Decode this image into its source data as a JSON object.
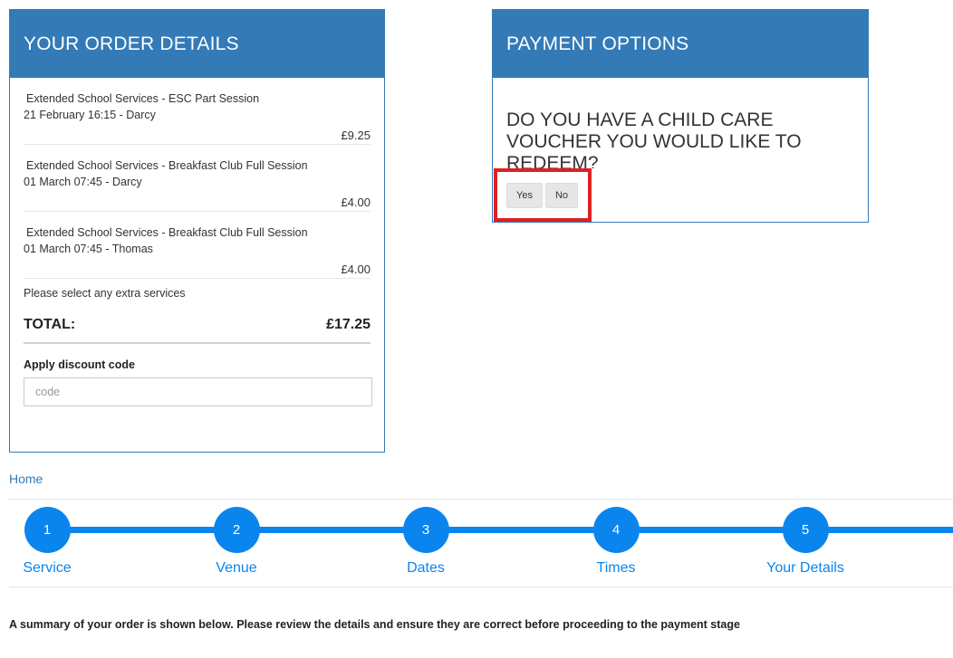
{
  "order": {
    "title": "YOUR ORDER DETAILS",
    "items": [
      {
        "name": "Extended School Services - ESC Part Session",
        "when": "21 February 16:15 - Darcy",
        "price": "£9.25"
      },
      {
        "name": "Extended School Services - Breakfast Club Full Session",
        "when": "01 March 07:45 - Darcy",
        "price": "£4.00"
      },
      {
        "name": "Extended School Services - Breakfast Club Full Session",
        "when": "01 March 07:45 - Thomas",
        "price": "£4.00"
      }
    ],
    "extras_text": "Please select any extra services",
    "total_label": "TOTAL:",
    "total_value": "£17.25",
    "discount_label": "Apply discount code",
    "discount_placeholder": "code",
    "discount_value": ""
  },
  "payment": {
    "title": "PAYMENT OPTIONS",
    "question": "DO YOU HAVE A CHILD CARE VOUCHER YOU WOULD LIKE TO REDEEM?",
    "yes_label": "Yes",
    "no_label": "No",
    "highlight_color": "#e01f26"
  },
  "breadcrumb": {
    "home_label": "Home"
  },
  "steps": [
    {
      "number": "1",
      "label": "Service"
    },
    {
      "number": "2",
      "label": "Venue"
    },
    {
      "number": "3",
      "label": "Dates"
    },
    {
      "number": "4",
      "label": "Times"
    },
    {
      "number": "5",
      "label": "Your Details"
    }
  ],
  "summary_text": "A summary of your order is shown below.  Please review the details and ensure they are correct before proceeding to the payment stage",
  "colors": {
    "brand": "#337ab7",
    "stepper": "#0a85ee"
  }
}
